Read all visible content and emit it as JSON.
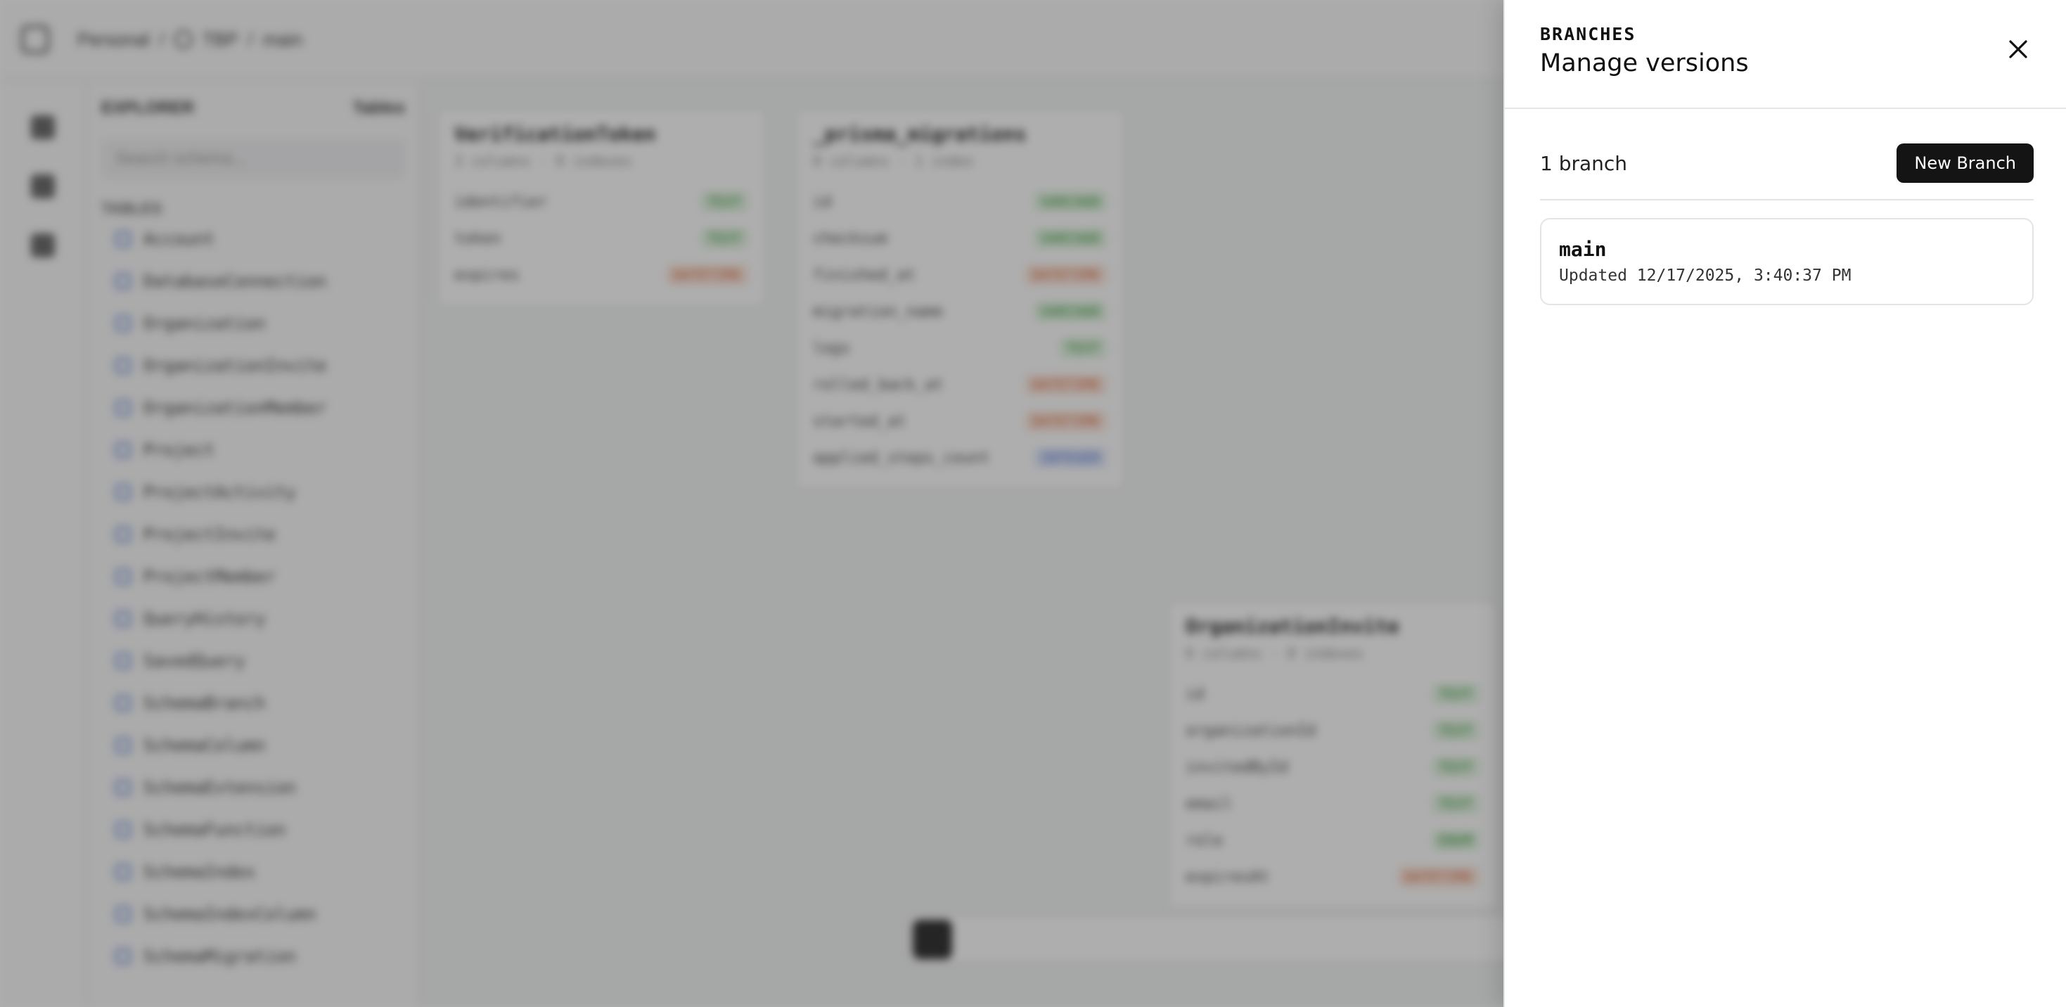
{
  "background": {
    "workspace": "Personal",
    "project": "TBP",
    "branch": "main",
    "explorer": {
      "title": "EXPLORER",
      "action": "Tables",
      "search_placeholder": "Search schema...",
      "section_label": "TABLES",
      "items": [
        "Account",
        "DatabaseConnection",
        "Organization",
        "OrganizationInvite",
        "OrganizationMember",
        "Project",
        "ProjectActivity",
        "ProjectInvite",
        "ProjectMember",
        "QueryHistory",
        "SavedQuery",
        "SchemaBranch",
        "SchemaColumn",
        "SchemaExtension",
        "SchemaFunction",
        "SchemaIndex",
        "SchemaIndexColumn",
        "SchemaMigration"
      ]
    },
    "nodes": [
      {
        "title": "VerificationToken",
        "sub": "3 columns · 0 indexes",
        "rows": [
          {
            "name": "identifier",
            "type": "TEXT",
            "tone": "g"
          },
          {
            "name": "token",
            "type": "TEXT",
            "tone": "g"
          },
          {
            "name": "expires",
            "type": "DATETIME",
            "tone": "o"
          }
        ]
      },
      {
        "title": "_prisma_migrations",
        "sub": "8 columns · 1 index",
        "rows": [
          {
            "name": "id",
            "type": "VARCHAR",
            "tone": "g"
          },
          {
            "name": "checksum",
            "type": "VARCHAR",
            "tone": "g"
          },
          {
            "name": "finished_at",
            "type": "DATETIME",
            "tone": "o"
          },
          {
            "name": "migration_name",
            "type": "VARCHAR",
            "tone": "g"
          },
          {
            "name": "logs",
            "type": "TEXT",
            "tone": "g"
          },
          {
            "name": "rolled_back_at",
            "type": "DATETIME",
            "tone": "o"
          },
          {
            "name": "started_at",
            "type": "DATETIME",
            "tone": "o"
          },
          {
            "name": "applied_steps_count",
            "type": "INTEGER",
            "tone": "b"
          }
        ]
      },
      {
        "title": "OrganizationInvite",
        "sub": "6 columns · 0 indexes",
        "rows": [
          {
            "name": "id",
            "type": "TEXT",
            "tone": "g"
          },
          {
            "name": "organizationId",
            "type": "TEXT",
            "tone": "g"
          },
          {
            "name": "invitedById",
            "type": "TEXT",
            "tone": "g"
          },
          {
            "name": "email",
            "type": "TEXT",
            "tone": "g"
          },
          {
            "name": "role",
            "type": "ENUM",
            "tone": "g"
          },
          {
            "name": "expiresAt",
            "type": "DATETIME",
            "tone": "o"
          }
        ]
      }
    ]
  },
  "sheet": {
    "eyebrow": "BRANCHES",
    "title": "Manage versions",
    "count_label": "1 branch",
    "new_branch_label": "New Branch",
    "branches": [
      {
        "name": "main",
        "updated": "Updated 12/17/2025, 3:40:37 PM"
      }
    ]
  }
}
